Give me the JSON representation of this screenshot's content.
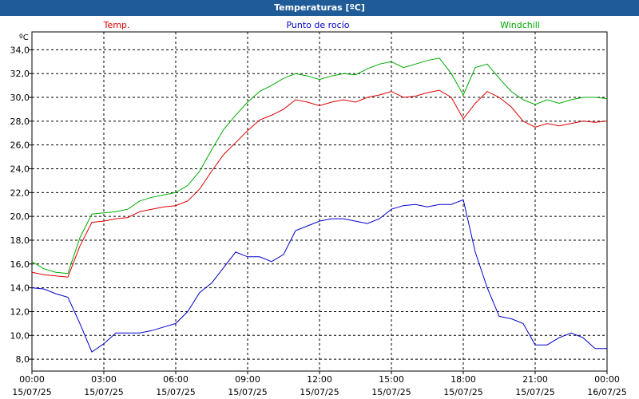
{
  "window": {
    "title": "Temperaturas [ºC]"
  },
  "chart_data": {
    "type": "line",
    "ylabel": "ºC",
    "ylim": [
      7.0,
      35.5
    ],
    "yticks": [
      "8,0",
      "10,0",
      "12,0",
      "14,0",
      "16,0",
      "18,0",
      "20,0",
      "22,0",
      "24,0",
      "26,0",
      "28,0",
      "30,0",
      "32,0",
      "34,0"
    ],
    "xticks": [
      {
        "time": "00:00",
        "date": "15/07/25"
      },
      {
        "time": "03:00",
        "date": "15/07/25"
      },
      {
        "time": "06:00",
        "date": "15/07/25"
      },
      {
        "time": "09:00",
        "date": "15/07/25"
      },
      {
        "time": "12:00",
        "date": "15/07/25"
      },
      {
        "time": "15:00",
        "date": "15/07/25"
      },
      {
        "time": "18:00",
        "date": "15/07/25"
      },
      {
        "time": "21:00",
        "date": "15/07/25"
      },
      {
        "time": "00:00",
        "date": "16/07/25"
      }
    ],
    "grid": true,
    "x": [
      "00:00",
      "00:30",
      "01:00",
      "01:30",
      "02:00",
      "02:30",
      "03:00",
      "03:30",
      "04:00",
      "04:30",
      "05:00",
      "05:30",
      "06:00",
      "06:30",
      "07:00",
      "07:30",
      "08:00",
      "08:30",
      "09:00",
      "09:30",
      "10:00",
      "10:30",
      "11:00",
      "11:30",
      "12:00",
      "12:30",
      "13:00",
      "13:30",
      "14:00",
      "14:30",
      "15:00",
      "15:30",
      "16:00",
      "16:30",
      "17:00",
      "17:30",
      "18:00",
      "18:30",
      "19:00",
      "19:30",
      "20:00",
      "20:30",
      "21:00",
      "21:30",
      "22:00",
      "22:30",
      "23:00",
      "23:30",
      "00:00"
    ],
    "series": [
      {
        "name": "Temp.",
        "color": "#dd0000",
        "values": [
          15.3,
          15.1,
          15.0,
          14.9,
          17.5,
          19.5,
          19.6,
          19.8,
          19.9,
          20.4,
          20.6,
          20.8,
          20.9,
          21.3,
          22.3,
          23.8,
          25.2,
          26.2,
          27.2,
          28.1,
          28.5,
          29.0,
          29.8,
          29.6,
          29.3,
          29.6,
          29.8,
          29.6,
          30.0,
          30.2,
          30.5,
          30.0,
          30.1,
          30.4,
          30.6,
          30.0,
          28.2,
          29.5,
          30.5,
          30.0,
          29.2,
          28.0,
          27.5,
          27.8,
          27.6,
          27.8,
          28.0,
          27.9,
          28.0
        ]
      },
      {
        "name": "Punto de rocío",
        "color": "#0000cc",
        "values": [
          14.0,
          13.9,
          13.5,
          13.2,
          11.0,
          8.6,
          9.3,
          10.2,
          10.2,
          10.2,
          10.4,
          10.7,
          11.0,
          12.0,
          13.6,
          14.4,
          15.7,
          17.0,
          16.6,
          16.6,
          16.2,
          16.8,
          18.8,
          19.2,
          19.6,
          19.8,
          19.8,
          19.6,
          19.4,
          19.8,
          20.6,
          20.9,
          21.0,
          20.8,
          21.0,
          21.0,
          21.4,
          17.0,
          14.0,
          11.6,
          11.4,
          11.0,
          9.2,
          9.2,
          9.8,
          10.2,
          9.8,
          8.9,
          8.9
        ]
      },
      {
        "name": "Windchill",
        "color": "#00aa00",
        "values": [
          16.2,
          15.6,
          15.3,
          15.2,
          18.2,
          20.2,
          20.3,
          20.4,
          20.6,
          21.3,
          21.6,
          21.8,
          22.0,
          22.6,
          23.8,
          25.6,
          27.3,
          28.5,
          29.6,
          30.5,
          31.0,
          31.6,
          32.0,
          31.8,
          31.5,
          31.8,
          32.0,
          31.9,
          32.4,
          32.8,
          33.0,
          32.5,
          32.8,
          33.1,
          33.3,
          32.0,
          30.2,
          32.5,
          32.8,
          31.6,
          30.5,
          29.8,
          29.4,
          29.8,
          29.5,
          29.8,
          30.0,
          30.0,
          29.9
        ]
      }
    ]
  }
}
